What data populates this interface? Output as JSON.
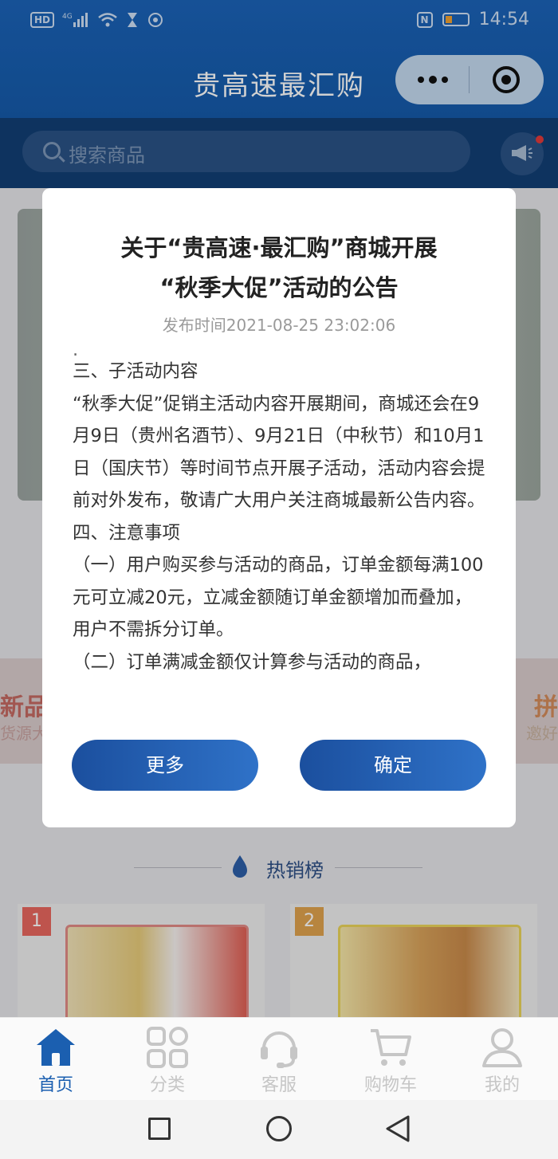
{
  "status_bar": {
    "network": "HD",
    "signal_label": "4G",
    "nfc": "N",
    "time": "14:54"
  },
  "header": {
    "title": "贵高速最汇购"
  },
  "search": {
    "placeholder": "搜索商品"
  },
  "features": {
    "left_title": "新品预",
    "left_sub": "货源大",
    "right_title": "拼",
    "right_sub": "邀好"
  },
  "hot_section": {
    "title": "热销榜",
    "items": [
      {
        "rank": "1",
        "badge_color": "#e8675e"
      },
      {
        "rank": "2",
        "badge_color": "#e0a34e"
      }
    ]
  },
  "announcement": {
    "title_line1": "关于“贵高速·最汇购”商城开展",
    "title_line2": "“秋季大促”活动的公告",
    "publish_time": "发布时间2021-08-25 23:02:06",
    "paragraphs": [
      "三、子活动内容",
      "“秋季大促”促销主活动内容开展期间，商城还会在9月9日（贵州名酒节）、9月21日（中秋节）和10月1日（国庆节）等时间节点开展子活动，活动内容会提前对外发布，敬请广大用户关注商城最新公告内容。",
      "四、注意事项",
      "（一）用户购买参与活动的商品，订单金额每满100元可立减20元，立减金额随订单金额增加而叠加，用户不需拆分订单。",
      "（二）订单满减金额仅计算参与活动的商品，"
    ],
    "more_label": "更多",
    "confirm_label": "确定"
  },
  "bottom_nav": {
    "items": [
      {
        "label": "首页",
        "icon": "home-icon",
        "active": true
      },
      {
        "label": "分类",
        "icon": "grid-icon",
        "active": false
      },
      {
        "label": "客服",
        "icon": "headset-icon",
        "active": false
      },
      {
        "label": "购物车",
        "icon": "cart-icon",
        "active": false
      },
      {
        "label": "我的",
        "icon": "user-icon",
        "active": false
      }
    ]
  },
  "colors": {
    "brand_blue": "#1b5fb0",
    "header_blue": "#1b63b8",
    "search_band": "#123f74"
  }
}
